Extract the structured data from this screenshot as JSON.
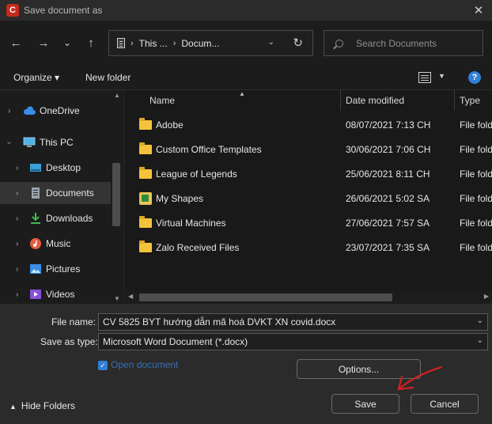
{
  "titlebar": {
    "title": "Save document as",
    "close": "✕"
  },
  "navigation": {
    "back": "←",
    "forward": "→",
    "recent": "⌄",
    "up": "↑",
    "crumbs": [
      "This ...",
      "Docum..."
    ],
    "refresh": "↻",
    "search_placeholder": "Search Documents"
  },
  "commandbar": {
    "organize": "Organize ▾",
    "new_folder": "New folder",
    "help": "?"
  },
  "tree": [
    {
      "label": "OneDrive",
      "icon": "cloud-icon",
      "color": "#3a8ee6"
    },
    {
      "label": "This PC",
      "icon": "computer-icon",
      "color": "#4fb3e8"
    },
    {
      "label": "Desktop",
      "icon": "desktop-icon",
      "color": "#3aa0d8"
    },
    {
      "label": "Documents",
      "icon": "documents-icon",
      "color": "#9aa3ad"
    },
    {
      "label": "Downloads",
      "icon": "download-icon",
      "color": "#3fb950"
    },
    {
      "label": "Music",
      "icon": "music-icon",
      "color": "#e55b3c"
    },
    {
      "label": "Pictures",
      "icon": "pictures-icon",
      "color": "#3a8ee6"
    },
    {
      "label": "Videos",
      "icon": "videos-icon",
      "color": "#8a4fd8"
    }
  ],
  "columns": {
    "name": "Name",
    "date": "Date modified",
    "type": "Type"
  },
  "files": [
    {
      "name": "Adobe",
      "date": "08/07/2021 7:13 CH",
      "type": "File folder",
      "icon": "folder-icon"
    },
    {
      "name": "Custom Office Templates",
      "date": "30/06/2021 7:06 CH",
      "type": "File folder",
      "icon": "folder-icon"
    },
    {
      "name": "League of Legends",
      "date": "25/06/2021 8:11 CH",
      "type": "File folder",
      "icon": "folder-icon"
    },
    {
      "name": "My Shapes",
      "date": "26/06/2021 5:02 SA",
      "type": "File folder",
      "icon": "shapes-icon"
    },
    {
      "name": "Virtual Machines",
      "date": "27/06/2021 7:57 SA",
      "type": "File folder",
      "icon": "folder-icon"
    },
    {
      "name": "Zalo Received Files",
      "date": "23/07/2021 7:35 SA",
      "type": "File folder",
      "icon": "folder-icon"
    }
  ],
  "form": {
    "file_name_label": "File name:",
    "file_name_value": "CV 5825 BYT hướng dẫn mã hoá DVKT XN covid.docx",
    "save_type_label": "Save as type:",
    "save_type_value": "Microsoft Word Document (*.docx)",
    "open_document_label": "Open document",
    "open_document_checked": true
  },
  "buttons": {
    "options": "Options...",
    "save": "Save",
    "cancel": "Cancel",
    "hide_folders": "Hide Folders"
  },
  "colors": {
    "annotation": "#d42020",
    "accent": "#2f7fd8"
  }
}
